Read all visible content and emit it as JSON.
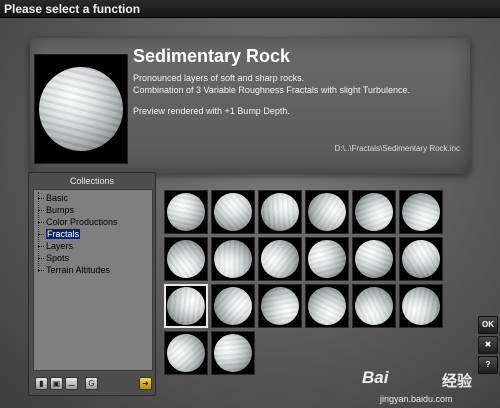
{
  "window": {
    "title": "Please select a function"
  },
  "preview": {
    "title": "Sedimentary Rock",
    "description_line1": "Pronounced layers of soft and sharp rocks.",
    "description_line2": "Combination of 3 Variable Roughness Fractals with slight Turbulence.",
    "note": "Preview rendered with +1 Bump Depth.",
    "path": "D:\\..\\Fractals\\Sedimentary Rock.inc"
  },
  "collections": {
    "header": "Collections",
    "items": [
      {
        "label": "Basic"
      },
      {
        "label": "Bumps"
      },
      {
        "label": "Color Productions"
      },
      {
        "label": "Fractals",
        "selected": true
      },
      {
        "label": "Layers"
      },
      {
        "label": "Spots"
      },
      {
        "label": "Terrain Altitudes"
      }
    ],
    "toolbar_icons": [
      "new-icon",
      "save-icon",
      "delete-icon",
      "info-icon",
      "arrow-right-icon"
    ]
  },
  "thumbnails": {
    "count": 20,
    "selected_index": 12
  },
  "side_buttons": {
    "ok": "OK",
    "close": "✖",
    "help": "?"
  },
  "watermark": {
    "logo": "Bai",
    "text": "经验",
    "url": "jingyan.baidu.com"
  },
  "colors": {
    "selection": "#0a246a",
    "background": "#5e5e5e"
  }
}
